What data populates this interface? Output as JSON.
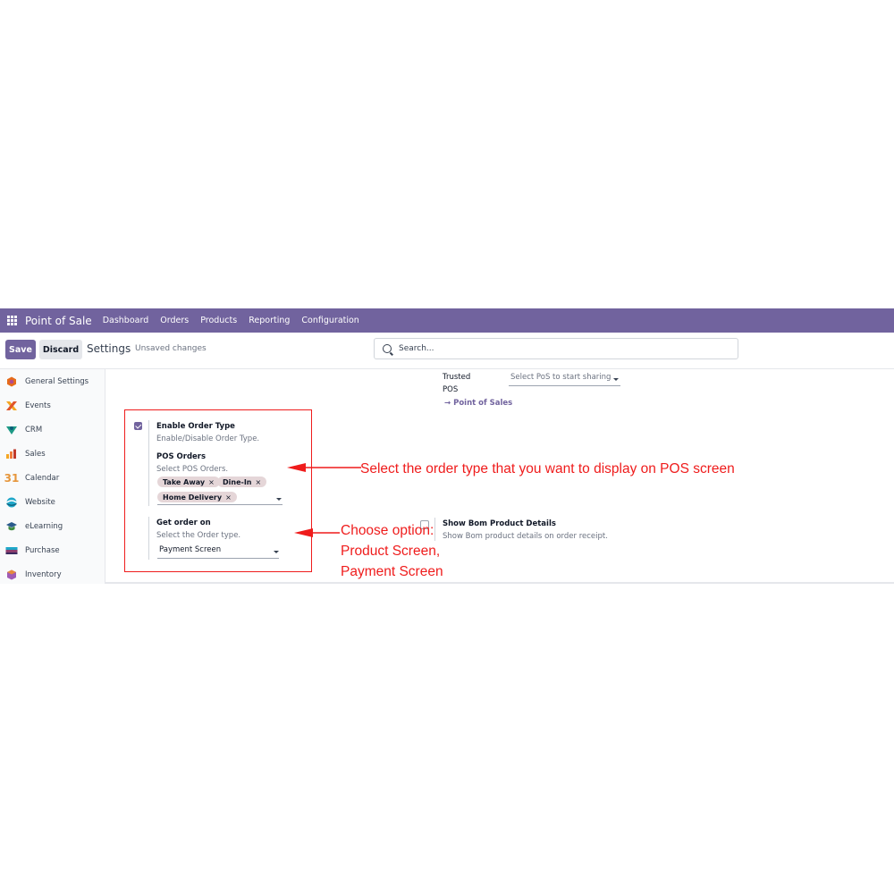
{
  "app": {
    "title": "Point of Sale"
  },
  "nav": [
    "Dashboard",
    "Orders",
    "Products",
    "Reporting",
    "Configuration"
  ],
  "control": {
    "save_label": "Save",
    "discard_label": "Discard",
    "title": "Settings",
    "status": "Unsaved changes",
    "search_placeholder": "Search..."
  },
  "sidebar": {
    "items": [
      {
        "label": "General Settings",
        "icon": "settings-hex-icon",
        "color": "#e66b1a"
      },
      {
        "label": "Events",
        "icon": "events-icon",
        "color": "#f5a623"
      },
      {
        "label": "CRM",
        "icon": "crm-icon",
        "color": "#1e9a86"
      },
      {
        "label": "Sales",
        "icon": "sales-icon",
        "color": "#f07b3b"
      },
      {
        "label": "Calendar",
        "icon": "calendar-icon",
        "color": "#e6963c",
        "glyph": "31"
      },
      {
        "label": "Website",
        "icon": "website-icon",
        "color": "#1fa7c9"
      },
      {
        "label": "eLearning",
        "icon": "elearning-icon",
        "color": "#2a5b8c"
      },
      {
        "label": "Purchase",
        "icon": "purchase-icon",
        "color": "#8a3d6e"
      },
      {
        "label": "Inventory",
        "icon": "inventory-icon",
        "color": "#a05bb5"
      }
    ]
  },
  "trusted": {
    "label_line1": "Trusted",
    "label_line2": "POS",
    "select_placeholder": "Select PoS to start sharing",
    "link": "Point of Sales",
    "link_arrow": "→"
  },
  "order_type": {
    "enabled": true,
    "title": "Enable Order Type",
    "desc": "Enable/Disable Order Type.",
    "pos_orders_label": "POS Orders",
    "pos_orders_desc": "Select POS Orders.",
    "tags": [
      "Take Away",
      "Dine-In",
      "Home Delivery"
    ],
    "tag_remove": "×",
    "get_order_label": "Get order on",
    "get_order_desc": "Select the Order type.",
    "get_order_value": "Payment Screen"
  },
  "bom": {
    "enabled": false,
    "title": "Show Bom Product Details",
    "desc": "Show Bom product details on order receipt."
  },
  "annotations": {
    "one": "Select the order type that you want to display on POS screen",
    "two_line1": "Choose option:",
    "two_line2": "Product Screen,",
    "two_line3": "Payment Screen",
    "color": "#ef1c1c"
  }
}
